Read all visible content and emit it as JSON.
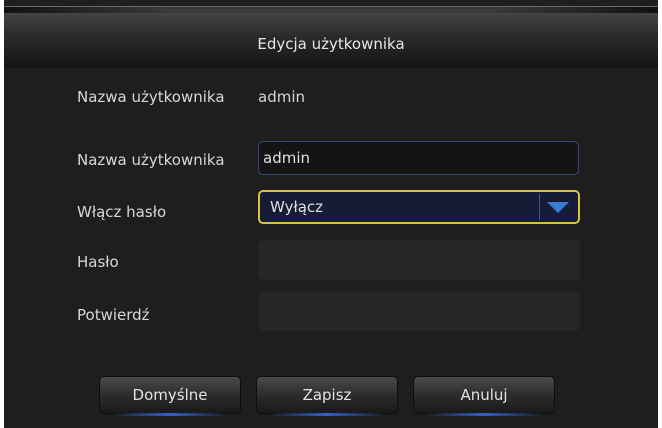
{
  "dialog": {
    "title": "Edycja użytkownika"
  },
  "info": {
    "label": "Nazwa użytkownika",
    "value": "admin"
  },
  "form": {
    "username": {
      "label": "Nazwa użytkownika",
      "value": "admin"
    },
    "enable_password": {
      "label": "Włącz hasło",
      "selected": "Wyłącz"
    },
    "password": {
      "label": "Hasło",
      "value": ""
    },
    "confirm": {
      "label": "Potwierdź",
      "value": ""
    }
  },
  "buttons": {
    "default_label": "Domyślne",
    "save_label": "Zapisz",
    "cancel_label": "Anuluj"
  },
  "colors": {
    "accent_focus": "#d9c33a",
    "accent_blue": "#3c7bd6"
  },
  "icons": {
    "select_arrow": "chevron-down-icon"
  }
}
